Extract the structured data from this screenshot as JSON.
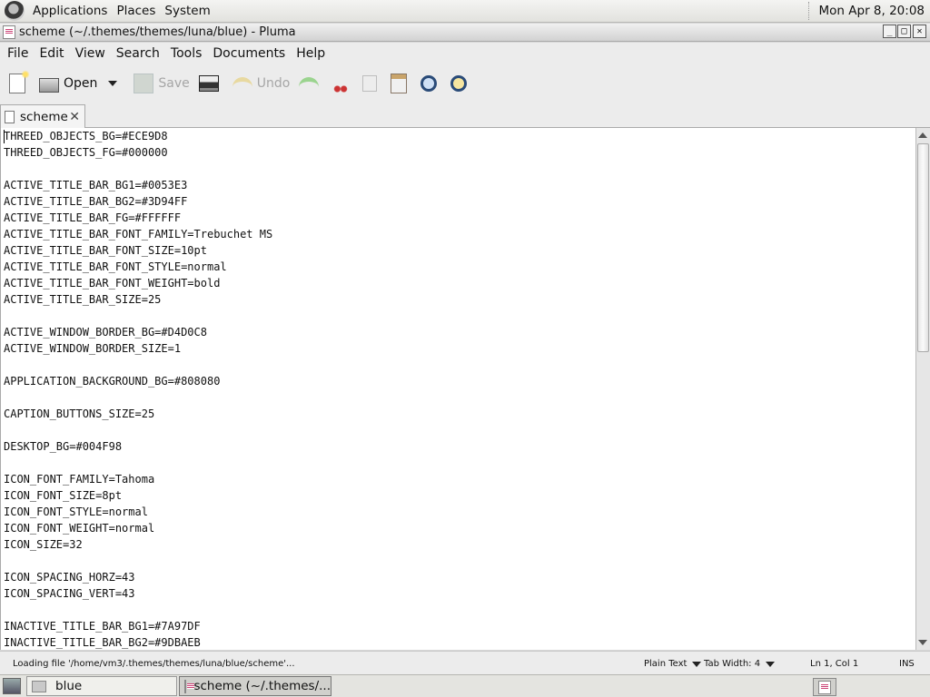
{
  "top_panel": {
    "menus": [
      "Applications",
      "Places",
      "System"
    ],
    "clock": "Mon Apr  8, 20:08"
  },
  "window": {
    "title": "scheme (~/.themes/themes/luna/blue) - Pluma",
    "buttons": {
      "minimize": "_",
      "maximize": "□",
      "close": "✕"
    }
  },
  "menubar": [
    "File",
    "Edit",
    "View",
    "Search",
    "Tools",
    "Documents",
    "Help"
  ],
  "toolbar": {
    "open_label": "Open",
    "save_label": "Save",
    "undo_label": "Undo"
  },
  "tab": {
    "label": "scheme"
  },
  "editor": {
    "lines": [
      "THREED_OBJECTS_BG=#ECE9D8",
      "THREED_OBJECTS_FG=#000000",
      "",
      "ACTIVE_TITLE_BAR_BG1=#0053E3",
      "ACTIVE_TITLE_BAR_BG2=#3D94FF",
      "ACTIVE_TITLE_BAR_FG=#FFFFFF",
      "ACTIVE_TITLE_BAR_FONT_FAMILY=Trebuchet MS",
      "ACTIVE_TITLE_BAR_FONT_SIZE=10pt",
      "ACTIVE_TITLE_BAR_FONT_STYLE=normal",
      "ACTIVE_TITLE_BAR_FONT_WEIGHT=bold",
      "ACTIVE_TITLE_BAR_SIZE=25",
      "",
      "ACTIVE_WINDOW_BORDER_BG=#D4D0C8",
      "ACTIVE_WINDOW_BORDER_SIZE=1",
      "",
      "APPLICATION_BACKGROUND_BG=#808080",
      "",
      "CAPTION_BUTTONS_SIZE=25",
      "",
      "DESKTOP_BG=#004F98",
      "",
      "ICON_FONT_FAMILY=Tahoma",
      "ICON_FONT_SIZE=8pt",
      "ICON_FONT_STYLE=normal",
      "ICON_FONT_WEIGHT=normal",
      "ICON_SIZE=32",
      "",
      "ICON_SPACING_HORZ=43",
      "ICON_SPACING_VERT=43",
      "",
      "INACTIVE_TITLE_BAR_BG1=#7A97DF",
      "INACTIVE_TITLE_BAR_BG2=#9DBAEB"
    ]
  },
  "statusbar": {
    "message": "Loading file '/home/vm3/.themes/themes/luna/blue/scheme'...",
    "language": "Plain Text",
    "tab_width": "Tab Width:  4",
    "position": "Ln 1, Col 1",
    "mode": "INS"
  },
  "taskbar": {
    "tasks": [
      "blue",
      "scheme (~/.themes/..."
    ]
  }
}
